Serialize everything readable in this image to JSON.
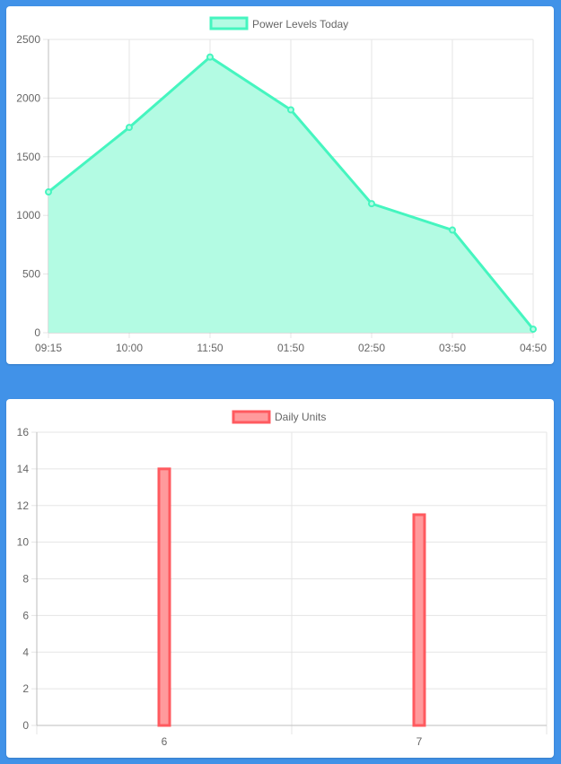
{
  "chart_data": [
    {
      "type": "area",
      "legend": "Power Levels Today",
      "categories": [
        "09:15",
        "10:00",
        "11:50",
        "01:50",
        "02:50",
        "03:50",
        "04:50"
      ],
      "series": [
        {
          "name": "Power Levels Today",
          "values": [
            1200,
            1750,
            2350,
            1900,
            1100,
            875,
            30
          ]
        }
      ],
      "yticks": [
        0,
        500,
        1000,
        1500,
        2000,
        2500
      ],
      "ylim": [
        0,
        2500
      ],
      "grid": true,
      "legend_position": "top",
      "colors": {
        "line": "#45f5bf",
        "fill": "#b3fbe3"
      }
    },
    {
      "type": "bar",
      "legend": "Daily Units",
      "categories": [
        "6",
        "7"
      ],
      "series": [
        {
          "name": "Daily Units",
          "values": [
            14,
            11.5
          ]
        }
      ],
      "yticks": [
        0,
        2,
        4,
        6,
        8,
        10,
        12,
        14,
        16
      ],
      "ylim": [
        0,
        16
      ],
      "grid": true,
      "legend_position": "top",
      "colors": {
        "border": "#ff5a5f",
        "fill": "#ff9a9c"
      }
    }
  ]
}
